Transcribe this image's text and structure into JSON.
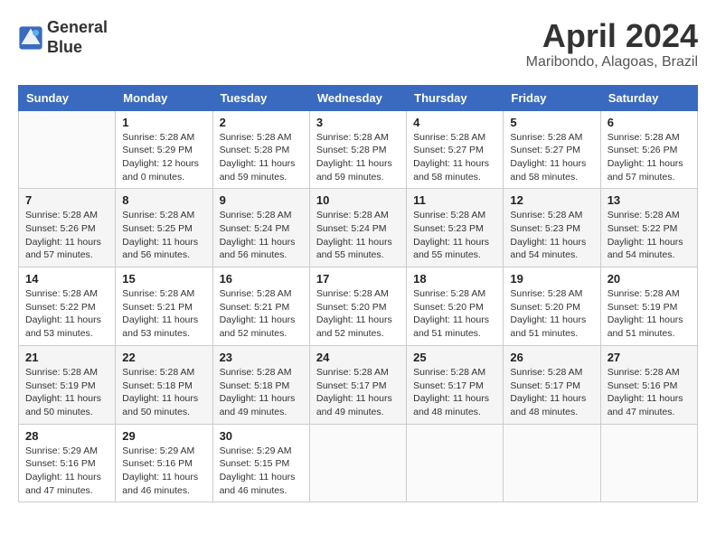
{
  "logo": {
    "line1": "General",
    "line2": "Blue"
  },
  "title": "April 2024",
  "subtitle": "Maribondo, Alagoas, Brazil",
  "weekdays": [
    "Sunday",
    "Monday",
    "Tuesday",
    "Wednesday",
    "Thursday",
    "Friday",
    "Saturday"
  ],
  "weeks": [
    [
      {
        "day": "",
        "info": ""
      },
      {
        "day": "1",
        "info": "Sunrise: 5:28 AM\nSunset: 5:29 PM\nDaylight: 12 hours\nand 0 minutes."
      },
      {
        "day": "2",
        "info": "Sunrise: 5:28 AM\nSunset: 5:28 PM\nDaylight: 11 hours\nand 59 minutes."
      },
      {
        "day": "3",
        "info": "Sunrise: 5:28 AM\nSunset: 5:28 PM\nDaylight: 11 hours\nand 59 minutes."
      },
      {
        "day": "4",
        "info": "Sunrise: 5:28 AM\nSunset: 5:27 PM\nDaylight: 11 hours\nand 58 minutes."
      },
      {
        "day": "5",
        "info": "Sunrise: 5:28 AM\nSunset: 5:27 PM\nDaylight: 11 hours\nand 58 minutes."
      },
      {
        "day": "6",
        "info": "Sunrise: 5:28 AM\nSunset: 5:26 PM\nDaylight: 11 hours\nand 57 minutes."
      }
    ],
    [
      {
        "day": "7",
        "info": "Sunrise: 5:28 AM\nSunset: 5:26 PM\nDaylight: 11 hours\nand 57 minutes."
      },
      {
        "day": "8",
        "info": "Sunrise: 5:28 AM\nSunset: 5:25 PM\nDaylight: 11 hours\nand 56 minutes."
      },
      {
        "day": "9",
        "info": "Sunrise: 5:28 AM\nSunset: 5:24 PM\nDaylight: 11 hours\nand 56 minutes."
      },
      {
        "day": "10",
        "info": "Sunrise: 5:28 AM\nSunset: 5:24 PM\nDaylight: 11 hours\nand 55 minutes."
      },
      {
        "day": "11",
        "info": "Sunrise: 5:28 AM\nSunset: 5:23 PM\nDaylight: 11 hours\nand 55 minutes."
      },
      {
        "day": "12",
        "info": "Sunrise: 5:28 AM\nSunset: 5:23 PM\nDaylight: 11 hours\nand 54 minutes."
      },
      {
        "day": "13",
        "info": "Sunrise: 5:28 AM\nSunset: 5:22 PM\nDaylight: 11 hours\nand 54 minutes."
      }
    ],
    [
      {
        "day": "14",
        "info": "Sunrise: 5:28 AM\nSunset: 5:22 PM\nDaylight: 11 hours\nand 53 minutes."
      },
      {
        "day": "15",
        "info": "Sunrise: 5:28 AM\nSunset: 5:21 PM\nDaylight: 11 hours\nand 53 minutes."
      },
      {
        "day": "16",
        "info": "Sunrise: 5:28 AM\nSunset: 5:21 PM\nDaylight: 11 hours\nand 52 minutes."
      },
      {
        "day": "17",
        "info": "Sunrise: 5:28 AM\nSunset: 5:20 PM\nDaylight: 11 hours\nand 52 minutes."
      },
      {
        "day": "18",
        "info": "Sunrise: 5:28 AM\nSunset: 5:20 PM\nDaylight: 11 hours\nand 51 minutes."
      },
      {
        "day": "19",
        "info": "Sunrise: 5:28 AM\nSunset: 5:20 PM\nDaylight: 11 hours\nand 51 minutes."
      },
      {
        "day": "20",
        "info": "Sunrise: 5:28 AM\nSunset: 5:19 PM\nDaylight: 11 hours\nand 51 minutes."
      }
    ],
    [
      {
        "day": "21",
        "info": "Sunrise: 5:28 AM\nSunset: 5:19 PM\nDaylight: 11 hours\nand 50 minutes."
      },
      {
        "day": "22",
        "info": "Sunrise: 5:28 AM\nSunset: 5:18 PM\nDaylight: 11 hours\nand 50 minutes."
      },
      {
        "day": "23",
        "info": "Sunrise: 5:28 AM\nSunset: 5:18 PM\nDaylight: 11 hours\nand 49 minutes."
      },
      {
        "day": "24",
        "info": "Sunrise: 5:28 AM\nSunset: 5:17 PM\nDaylight: 11 hours\nand 49 minutes."
      },
      {
        "day": "25",
        "info": "Sunrise: 5:28 AM\nSunset: 5:17 PM\nDaylight: 11 hours\nand 48 minutes."
      },
      {
        "day": "26",
        "info": "Sunrise: 5:28 AM\nSunset: 5:17 PM\nDaylight: 11 hours\nand 48 minutes."
      },
      {
        "day": "27",
        "info": "Sunrise: 5:28 AM\nSunset: 5:16 PM\nDaylight: 11 hours\nand 47 minutes."
      }
    ],
    [
      {
        "day": "28",
        "info": "Sunrise: 5:29 AM\nSunset: 5:16 PM\nDaylight: 11 hours\nand 47 minutes."
      },
      {
        "day": "29",
        "info": "Sunrise: 5:29 AM\nSunset: 5:16 PM\nDaylight: 11 hours\nand 46 minutes."
      },
      {
        "day": "30",
        "info": "Sunrise: 5:29 AM\nSunset: 5:15 PM\nDaylight: 11 hours\nand 46 minutes."
      },
      {
        "day": "",
        "info": ""
      },
      {
        "day": "",
        "info": ""
      },
      {
        "day": "",
        "info": ""
      },
      {
        "day": "",
        "info": ""
      }
    ]
  ]
}
